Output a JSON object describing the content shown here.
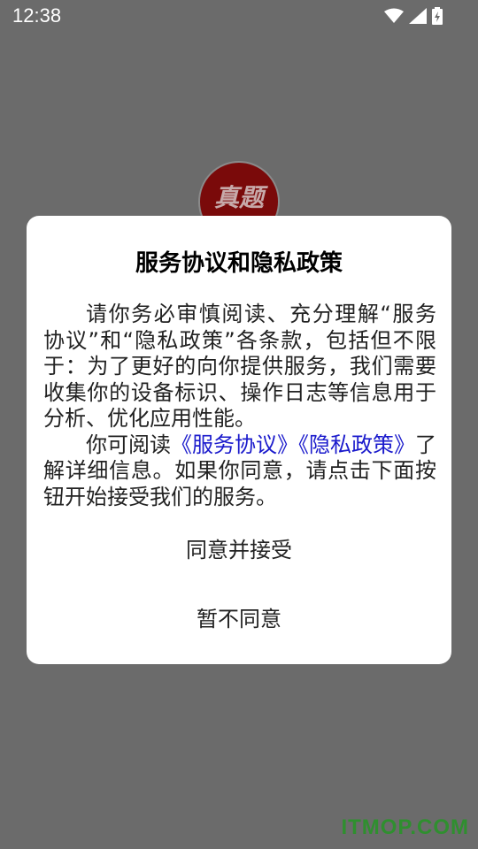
{
  "status_bar": {
    "time": "12:38",
    "icons": [
      "wifi-icon",
      "signal-icon",
      "battery-charging-icon"
    ]
  },
  "app_logo": {
    "text": "真题"
  },
  "dialog": {
    "title": "服务协议和隐私政策",
    "para1": "请你务必审慎阅读、充分理解“服务协议”和“隐私政策”各条款，包括但不限于：为了更好的向你提供服务，我们需要收集你的设备标识、操作日志等信息用于分析、优化应用性能。",
    "para2_prefix": "你可阅读",
    "link_service": "《服务协议》",
    "link_privacy": "《隐私政策》",
    "para2_suffix": "了解详细信息。如果你同意，请点击下面按钮开始接受我们的服务。",
    "agree_label": "同意并接受",
    "decline_label": "暂不同意"
  },
  "watermark": "ITMOP.COM",
  "colors": {
    "overlay": "#6b6b6b",
    "link": "#1a1acc",
    "logo_bg": "#7a0a0a",
    "watermark": "#2f8f2f"
  }
}
